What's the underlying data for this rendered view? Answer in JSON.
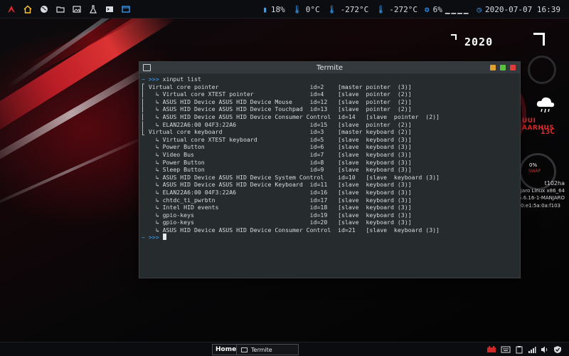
{
  "topbar": {
    "icons": [
      "arch-logo-icon",
      "home-icon",
      "globe-icon",
      "folder-icon",
      "image-icon",
      "flask-icon",
      "terminal-icon",
      "window-icon"
    ],
    "battery": "18%",
    "temp1": "0°C",
    "temp2": "-272°C",
    "temp3": "-272°C",
    "cpu": "6%",
    "cpu_bars": "▁▁▁▁",
    "datetime": "2020-07-07 16:39"
  },
  "conky": {
    "year": "2020",
    "weather_name": "UUI AARHUS",
    "weather_temp": "13C",
    "swap_pct": "0%",
    "swap_label": "SWAP",
    "hostname": "t102ha",
    "os": "Manjaro Linux x86_64",
    "kernel": "5.6.16-1-MANJARO",
    "mac": "58:00:e3:34:d0:e1:5a:0a:f103"
  },
  "terminal": {
    "title": "Termite",
    "prompt_symbol": "~ >>>",
    "command": "xinput list",
    "lines": [
      "⎡ Virtual core pointer                          id=2    [master pointer  (3)]",
      "⎜   ↳ Virtual core XTEST pointer                id=4    [slave  pointer  (2)]",
      "⎜   ↳ ASUS HID Device ASUS HID Device Mouse     id=12   [slave  pointer  (2)]",
      "⎜   ↳ ASUS HID Device ASUS HID Device Touchpad  id=13   [slave  pointer  (2)]",
      "⎜   ↳ ASUS HID Device ASUS HID Device Consumer Control  id=14   [slave  pointer  (2)]",
      "⎜   ↳ ELAN22A6:00 04F3:22A6                     id=15   [slave  pointer  (2)]",
      "⎣ Virtual core keyboard                         id=3    [master keyboard (2)]",
      "    ↳ Virtual core XTEST keyboard               id=5    [slave  keyboard (3)]",
      "    ↳ Power Button                              id=6    [slave  keyboard (3)]",
      "    ↳ Video Bus                                 id=7    [slave  keyboard (3)]",
      "    ↳ Power Button                              id=8    [slave  keyboard (3)]",
      "    ↳ Sleep Button                              id=9    [slave  keyboard (3)]",
      "    ↳ ASUS HID Device ASUS HID Device System Control    id=10   [slave  keyboard (3)]",
      "    ↳ ASUS HID Device ASUS HID Device Keyboard  id=11   [slave  keyboard (3)]",
      "    ↳ ELAN22A6:00 04F3:22A6                     id=16   [slave  keyboard (3)]",
      "    ↳ chtdc_ti_pwrbtn                           id=17   [slave  keyboard (3)]",
      "    ↳ Intel HID events                          id=18   [slave  keyboard (3)]",
      "    ↳ gpio-keys                                 id=19   [slave  keyboard (3)]",
      "    ↳ gpio-keys                                 id=20   [slave  keyboard (3)]",
      "    ↳ ASUS HID Device ASUS HID Device Consumer Control  id=21   [slave  keyboard (3)]"
    ]
  },
  "taskbar": {
    "home_label": "Home",
    "terminal_task_label": "Termite",
    "tray_icons": [
      "network-adapter-icon",
      "keyboard-layout-icon",
      "clipboard-icon",
      "wifi-signal-icon",
      "volume-icon",
      "shield-check-icon"
    ]
  },
  "colors": {
    "accent_blue": "#3aa0ff",
    "accent_red": "#e02a2a",
    "terminal_bg": "#262b2e"
  }
}
